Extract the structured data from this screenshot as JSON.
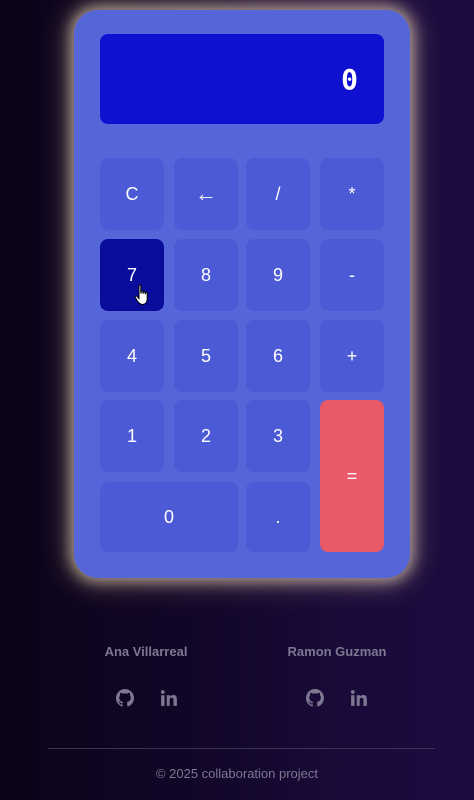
{
  "display": {
    "value": "0"
  },
  "keys": {
    "clear": "C",
    "backspace": "←",
    "divide": "/",
    "multiply": "*",
    "seven": "7",
    "eight": "8",
    "nine": "9",
    "minus": "-",
    "four": "4",
    "five": "5",
    "six": "6",
    "plus": "+",
    "one": "1",
    "two": "2",
    "three": "3",
    "equals": "=",
    "zero": "0",
    "dot": "."
  },
  "colors": {
    "calculator_body": "#5566d8",
    "display_bg": "#1010d0",
    "key_bg": "#4d5ad6",
    "key_active": "#0a0c9c",
    "equals_bg": "#e8596a"
  },
  "footer": {
    "authors": [
      {
        "name": "Ana Villarreal",
        "icons": [
          "github-icon",
          "linkedin-icon"
        ]
      },
      {
        "name": "Ramon Guzman",
        "icons": [
          "github-icon",
          "linkedin-icon"
        ]
      }
    ],
    "copyright": "© 2025 collaboration project"
  }
}
